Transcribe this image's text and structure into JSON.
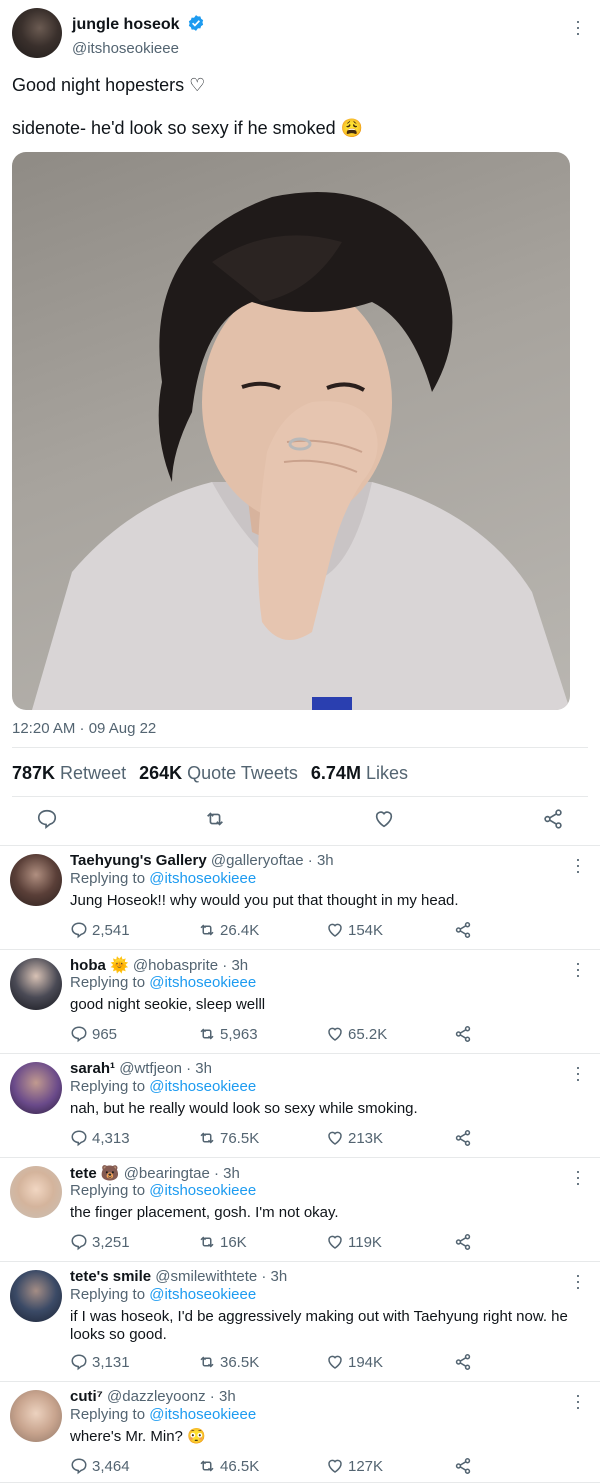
{
  "tweet": {
    "author_name": "jungle hoseok",
    "author_handle": "@itshoseokieee",
    "text_line1": "Good night hopesters ♡",
    "text_line2": "sidenote- he'd look so sexy if he smoked 😩",
    "timestamp": "12:20 AM · 09 Aug 22",
    "stats": {
      "retweets": "787K",
      "retweets_label": "Retweet",
      "quotes": "264K",
      "quotes_label": "Quote Tweets",
      "likes": "6.74M",
      "likes_label": "Likes"
    }
  },
  "icons": {
    "reply": "reply-icon",
    "retweet": "retweet-icon",
    "like": "heart-icon",
    "share": "share-icon",
    "more": "more-icon",
    "verified": "verified-icon"
  },
  "colors": {
    "link": "#1d9bf0",
    "secondary_text": "#536471",
    "divider": "#e7e9ea"
  },
  "replies": [
    {
      "name": "Taehyung's Gallery",
      "handle": "@galleryoftae · 3h",
      "replying_prefix": "Replying to",
      "replying_to": "@itshoseokieee",
      "text": "Jung Hoseok!! why would you put that thought in my head.",
      "replies": "2,541",
      "retweets": "26.4K",
      "likes": "154K"
    },
    {
      "name": "hoba 🌞",
      "handle": "@hobasprite · 3h",
      "replying_prefix": "Replying to",
      "replying_to": "@itshoseokieee",
      "text": "good night seokie, sleep welll",
      "replies": "965",
      "retweets": "5,963",
      "likes": "65.2K"
    },
    {
      "name": "sarah¹",
      "handle": "@wtfjeon · 3h",
      "replying_prefix": "Replying to",
      "replying_to": "@itshoseokieee",
      "text": "nah, but he really would look so sexy while smoking.",
      "replies": "4,313",
      "retweets": "76.5K",
      "likes": "213K"
    },
    {
      "name": "tete 🐻",
      "handle": "@bearingtae · 3h",
      "replying_prefix": "Replying to",
      "replying_to": "@itshoseokieee",
      "text": "the finger placement, gosh. I'm not okay.",
      "replies": "3,251",
      "retweets": "16K",
      "likes": "119K"
    },
    {
      "name": "tete's smile",
      "handle": "@smilewithtete · 3h",
      "replying_prefix": "Replying to",
      "replying_to": "@itshoseokieee",
      "text": "if I was hoseok, I'd be aggressively making out with Taehyung right now. he looks so good.",
      "replies": "3,131",
      "retweets": "36.5K",
      "likes": "194K"
    },
    {
      "name": "cuti⁷",
      "handle": "@dazzleyoonz · 3h",
      "replying_prefix": "Replying to",
      "replying_to": "@itshoseokieee",
      "text": "where's Mr. Min? 😳",
      "replies": "3,464",
      "retweets": "46.5K",
      "likes": "127K"
    }
  ]
}
